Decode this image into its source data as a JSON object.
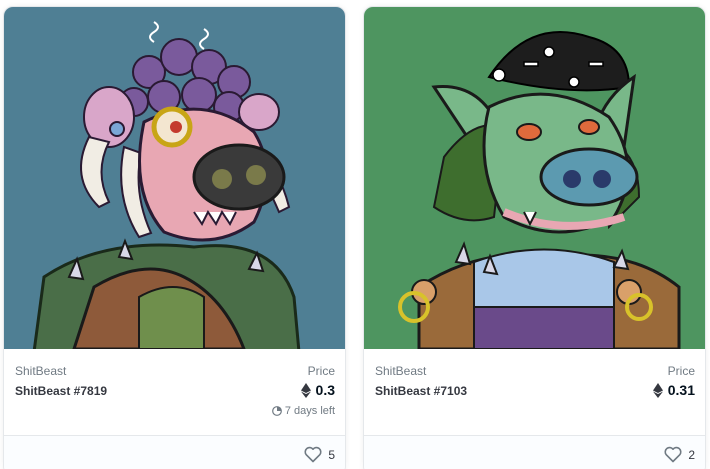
{
  "cards": [
    {
      "collection": "ShitBeast",
      "name": "ShitBeast #7819",
      "price_label": "Price",
      "price": "0.3",
      "currency_icon": "ethereum-icon",
      "time_left": "7 days left",
      "likes": "5",
      "bg_color": "#4f7f94"
    },
    {
      "collection": "ShitBeast",
      "name": "ShitBeast #7103",
      "price_label": "Price",
      "price": "0.31",
      "currency_icon": "ethereum-icon",
      "likes": "2",
      "bg_color": "#4e9560"
    }
  ]
}
